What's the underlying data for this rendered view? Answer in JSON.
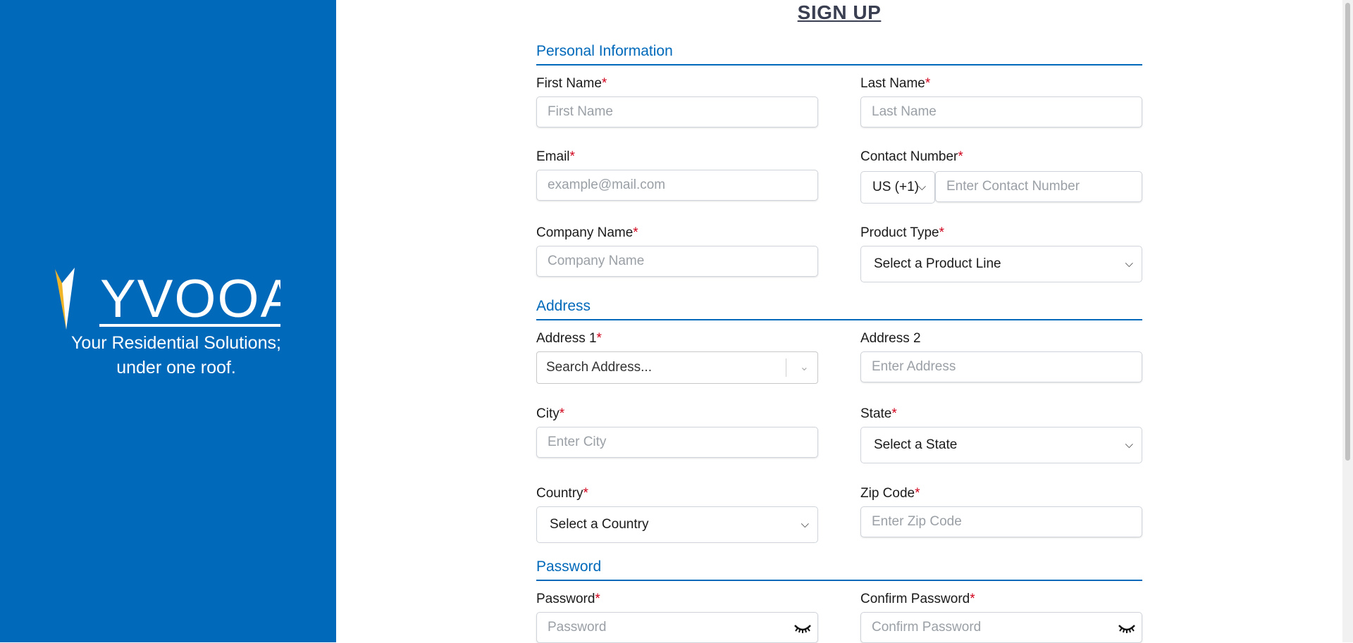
{
  "brand": {
    "logo_text": "YVOOA",
    "tagline_line1": "Your Residential Solutions;",
    "tagline_line2": "under one roof."
  },
  "form": {
    "title": "SIGN UP",
    "sections": {
      "personal": "Personal Information",
      "address": "Address",
      "password": "Password"
    },
    "first_name": {
      "label": "First Name",
      "placeholder": "First Name"
    },
    "last_name": {
      "label": "Last Name",
      "placeholder": "Last Name"
    },
    "email": {
      "label": "Email",
      "placeholder": "example@mail.com"
    },
    "contact": {
      "label": "Contact Number",
      "country_code": "US (+1)",
      "placeholder": "Enter Contact Number"
    },
    "company": {
      "label": "Company Name",
      "placeholder": "Company Name"
    },
    "product_type": {
      "label": "Product Type",
      "value": "Select a Product Line"
    },
    "address1": {
      "label": "Address 1",
      "placeholder": "Search Address..."
    },
    "address2": {
      "label": "Address 2",
      "placeholder": "Enter Address"
    },
    "city": {
      "label": "City",
      "placeholder": "Enter City"
    },
    "state": {
      "label": "State",
      "value": "Select a State"
    },
    "country": {
      "label": "Country",
      "value": "Select a Country"
    },
    "zip": {
      "label": "Zip Code",
      "placeholder": "Enter Zip Code"
    },
    "password": {
      "label": "Password",
      "placeholder": "Password"
    },
    "confirm_password": {
      "label": "Confirm Password",
      "placeholder": "Confirm Password"
    },
    "required_mark": "*"
  },
  "colors": {
    "brand_blue": "#0069ba",
    "accent_gold": "#f0b429",
    "required_red": "#d0021b"
  }
}
